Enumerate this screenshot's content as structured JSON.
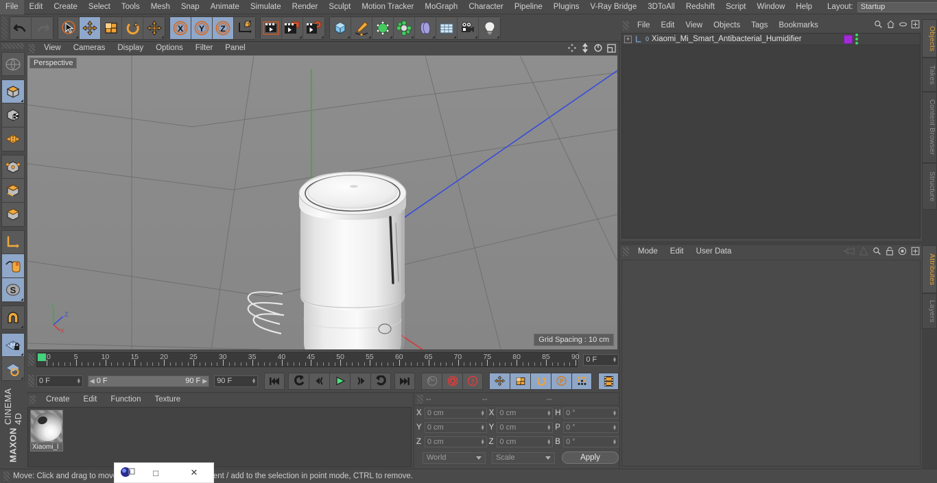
{
  "menubar": {
    "items": [
      "File",
      "Edit",
      "Create",
      "Select",
      "Tools",
      "Mesh",
      "Snap",
      "Animate",
      "Simulate",
      "Render",
      "Sculpt",
      "Motion Tracker",
      "MoGraph",
      "Character",
      "Pipeline",
      "Plugins",
      "V-Ray Bridge",
      "3DToAll",
      "Redshift",
      "Script",
      "Window",
      "Help"
    ],
    "layout_label": "Layout:",
    "layout_value": "Startup",
    "search_icon": "search-icon"
  },
  "toolbar": {
    "undo": "undo-icon",
    "redo": "redo-icon",
    "live_selection": "live-selection-icon",
    "move": "move-icon",
    "scale": "scale-icon",
    "rotate": "rotate-icon",
    "move_alt": "move-alt-icon",
    "axis_x": "X",
    "axis_y": "Y",
    "axis_z": "Z",
    "world_coord": "world-coordinate-icon",
    "render_view": "render-view-icon",
    "render_region": "render-to-picture-viewer-icon",
    "render_settings": "render-settings-icon",
    "primitive_cube": "cube-primitive-icon",
    "spline_pen": "spline-pen-icon",
    "generator": "generator-icon",
    "deformer": "deformer-icon",
    "bend": "bend-icon",
    "scene_floor": "scene-floor-icon",
    "camera": "camera-icon",
    "light": "light-icon"
  },
  "lefttools": {
    "items": [
      {
        "name": "undo-view-icon",
        "selected": false
      },
      {
        "name": "model-mode-icon",
        "selected": true
      },
      {
        "name": "texture-mode-icon",
        "selected": false
      },
      {
        "name": "points-mode-icon",
        "selected": false
      },
      {
        "name": "edges-mode-icon",
        "selected": false
      },
      {
        "name": "polygons-mode-icon",
        "selected": false
      },
      {
        "name": "object-axis-icon",
        "selected": false
      },
      {
        "name": "enable-axis-icon",
        "selected": false
      },
      {
        "name": "viewport-solo-icon",
        "selected": true
      },
      {
        "name": "snap-s-icon",
        "selected": true
      },
      {
        "name": "magnet-icon",
        "selected": false
      },
      {
        "name": "workplane-lock-icon",
        "selected": true
      },
      {
        "name": "workplane-rotate-icon",
        "selected": false
      }
    ],
    "brand_bold": "MAXON",
    "brand_name": "CINEMA 4D"
  },
  "viewport": {
    "menu": [
      "View",
      "Cameras",
      "Display",
      "Options",
      "Filter",
      "Panel"
    ],
    "label": "Perspective",
    "grid_spacing": "Grid Spacing : 10 cm",
    "axis_x": "X",
    "axis_y": "Y",
    "axis_z": "Z",
    "icons": [
      "move-view-icon",
      "zoom-view-icon",
      "rotate-view-icon",
      "maximize-view-icon"
    ],
    "model_name": "Xiaomi Mi Smart Antibacterial Humidifier"
  },
  "timeline": {
    "ticks": [
      "0",
      "5",
      "10",
      "15",
      "20",
      "25",
      "30",
      "35",
      "40",
      "45",
      "50",
      "55",
      "60",
      "65",
      "70",
      "75",
      "80",
      "85",
      "90"
    ],
    "current_frame_right": "0 F",
    "current_frame_left": "0 F",
    "range_start": "0 F",
    "range_end": "90 F",
    "end_frame": "90 F",
    "buttons": [
      {
        "name": "go-to-start-button",
        "icon": "skip-start-icon"
      },
      {
        "name": "frame-back-button",
        "icon": "rewind-icon"
      },
      {
        "name": "step-back-button",
        "icon": "step-back-icon"
      },
      {
        "name": "play-button",
        "icon": "play-icon"
      },
      {
        "name": "step-forward-button",
        "icon": "step-forward-icon"
      },
      {
        "name": "frame-forward-button",
        "icon": "fast-forward-icon"
      },
      {
        "name": "go-to-end-button",
        "icon": "skip-end-icon"
      }
    ],
    "record_buttons": [
      {
        "name": "autokeying-button",
        "icon": "key-icon"
      },
      {
        "name": "record-active-objects-button",
        "icon": "record-icon"
      },
      {
        "name": "keyframe-selection-button",
        "icon": "question-icon"
      }
    ],
    "key_toggles": [
      {
        "name": "position-key-toggle",
        "icon": "move-icon",
        "selected": true
      },
      {
        "name": "scale-key-toggle",
        "icon": "scale-icon",
        "selected": true
      },
      {
        "name": "rotation-key-toggle",
        "icon": "rotate-icon",
        "selected": true
      },
      {
        "name": "param-key-toggle",
        "icon": "p-icon",
        "selected": true
      },
      {
        "name": "pla-key-toggle",
        "icon": "dots-icon",
        "selected": false
      },
      {
        "name": "timeline-toggle",
        "icon": "filmstrip-icon",
        "selected": true
      }
    ]
  },
  "material_manager": {
    "menu": [
      "Create",
      "Edit",
      "Function",
      "Texture"
    ],
    "materials": [
      {
        "name": "Xiaomi_l",
        "thumb": "material-sphere-preview"
      }
    ]
  },
  "coordinates": {
    "headers": [
      "--",
      "--",
      "--"
    ],
    "rows": [
      {
        "label_pos": "X",
        "value_pos": "0 cm",
        "label_size": "X",
        "value_size": "0 cm",
        "label_rot": "H",
        "value_rot": "0 °"
      },
      {
        "label_pos": "Y",
        "value_pos": "0 cm",
        "label_size": "Y",
        "value_size": "0 cm",
        "label_rot": "P",
        "value_rot": "0 °"
      },
      {
        "label_pos": "Z",
        "value_pos": "0 cm",
        "label_size": "Z",
        "value_size": "0 cm",
        "label_rot": "B",
        "value_rot": "0 °"
      }
    ],
    "coord_system": "World",
    "transform_mode": "Scale",
    "apply_label": "Apply"
  },
  "object_manager": {
    "menu": [
      "File",
      "Edit",
      "View",
      "Objects",
      "Tags",
      "Bookmarks"
    ],
    "icons": [
      "search-icon",
      "home-icon",
      "ellipse-icon",
      "add-layer-icon"
    ],
    "rows": [
      {
        "name": "Xiaomi_Mi_Smart_Antibacterial_Humidifier",
        "level_badge": "0",
        "expandable": "+"
      }
    ]
  },
  "attribute_manager": {
    "menu": [
      "Mode",
      "Edit",
      "User Data"
    ],
    "icons": [
      "prev-nav-icon",
      "next-nav-icon",
      "search-icon",
      "lock-icon",
      "target-icon",
      "add-tab-icon"
    ]
  },
  "right_tabs": {
    "top": [
      {
        "label": "Objects",
        "active": true
      },
      {
        "label": "Takes",
        "active": false
      },
      {
        "label": "Content Browser",
        "active": false
      },
      {
        "label": "Structure",
        "active": false
      }
    ],
    "bottom": [
      {
        "label": "Attributes",
        "active": true
      },
      {
        "label": "Layers",
        "active": false
      }
    ]
  },
  "statusbar": {
    "text": "Move: Click and drag to move, SHIFT to quantize movement / add to the selection in point mode, CTRL to remove."
  },
  "mini_window": {
    "app_icon": "app-icon",
    "restore_label": "❐",
    "maximize_label": "□",
    "close_label": "✕"
  },
  "colors": {
    "accent_orange": "#e2a33c",
    "selection_blue": "#8fa7c9",
    "panel_bg": "#4a4a4a",
    "viewport_bg": "#8a8a8a",
    "timeline_green": "#45d17e",
    "tag_purple": "#a32bd6"
  }
}
